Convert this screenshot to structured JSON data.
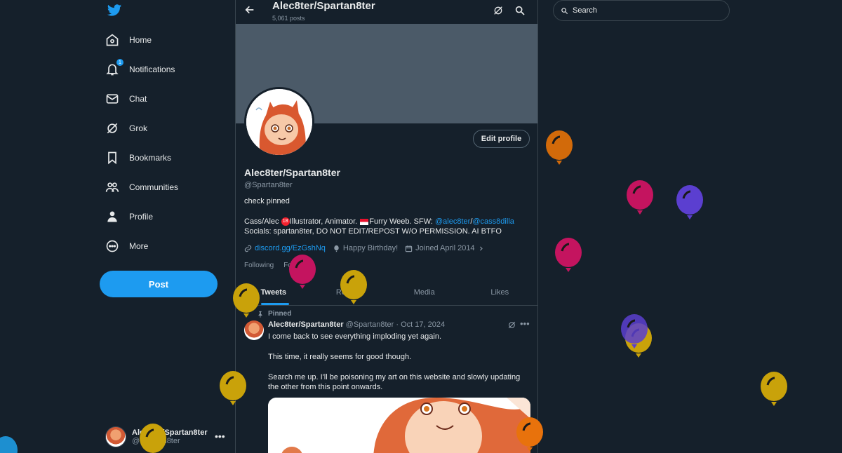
{
  "nav": {
    "items": [
      {
        "label": "Home",
        "icon": "home-icon"
      },
      {
        "label": "Notifications",
        "icon": "bell-icon",
        "badge": "1"
      },
      {
        "label": "Chat",
        "icon": "mail-icon"
      },
      {
        "label": "Grok",
        "icon": "grok-icon"
      },
      {
        "label": "Bookmarks",
        "icon": "bookmark-icon"
      },
      {
        "label": "Communities",
        "icon": "communities-icon"
      },
      {
        "label": "Profile",
        "icon": "person-icon"
      },
      {
        "label": "More",
        "icon": "more-circle-icon"
      }
    ],
    "post_label": "Post"
  },
  "account": {
    "name": "Alec8ter/Spartan8ter",
    "handle": "@Spartan8ter"
  },
  "topbar": {
    "title": "Alec8ter/Spartan8ter",
    "post_count": "5,061 posts"
  },
  "profile": {
    "name": "Alec8ter/Spartan8ter",
    "handle": "@Spartan8ter",
    "edit_label": "Edit profile",
    "pinned_note": "check pinned",
    "bio_line1_a": "Cass/Alec",
    "bio_line1_age": "18",
    "bio_line1_b": "Illustrator, Animator.",
    "bio_line1_c": "Furry Weeb. SFW:",
    "bio_link1": "@alec8ter",
    "bio_sep": "/",
    "bio_link2": "@cass8dilla",
    "bio_line2": "Socials: spartan8ter, DO NOT EDIT/REPOST W/O PERMISSION. AI BTFO",
    "link": "discord.gg/EzGshNq",
    "birthday": "Happy Birthday!",
    "joined": "Joined April 2014",
    "following_label": "Following",
    "followers_label": "Followers"
  },
  "tabs": [
    "Tweets",
    "Replies",
    "Media",
    "Likes"
  ],
  "active_tab": "Tweets",
  "tweet": {
    "pinned_label": "Pinned",
    "name": "Alec8ter/Spartan8ter",
    "meta": "@Spartan8ter · Oct 17, 2024",
    "p1": "I come back to see everything imploding yet again.",
    "p2": "This time, it really seems for good though.",
    "p3": "Search me up. I'll be poisoning my art on this website and slowly updating the other from this point onwards."
  },
  "search": {
    "placeholder": "Search"
  },
  "colors": {
    "background": "#15202b",
    "accent": "#1d9bf0",
    "balloon_orange": "#e8720c",
    "balloon_pink": "#c4145f",
    "balloon_purple": "#5b3fd0",
    "balloon_yellow": "#c9a20a"
  }
}
